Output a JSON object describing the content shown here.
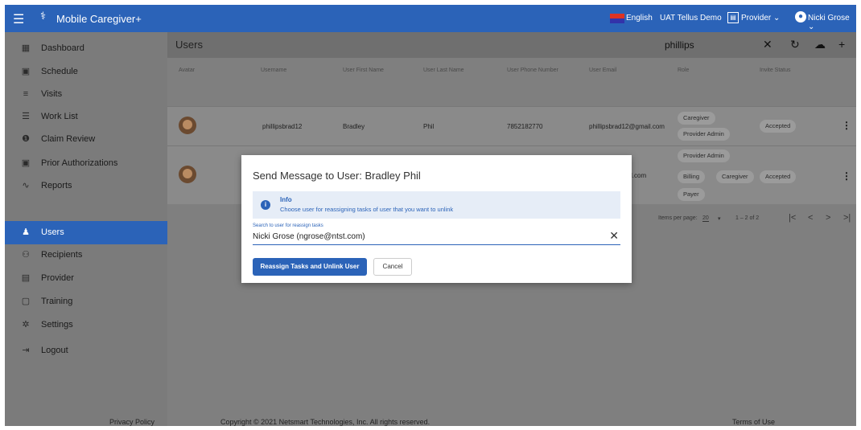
{
  "app": {
    "title": "Mobile Caregiver+"
  },
  "topbar": {
    "language": "English",
    "environment": "UAT Tellus Demo",
    "role_menu": "Provider",
    "user_menu": "Nicki Grose"
  },
  "sidebar": {
    "items": [
      {
        "label": "Dashboard",
        "icon": "dashboard-icon"
      },
      {
        "label": "Schedule",
        "icon": "calendar-icon"
      },
      {
        "label": "Visits",
        "icon": "filter-icon"
      },
      {
        "label": "Work List",
        "icon": "list-icon"
      },
      {
        "label": "Claim Review",
        "icon": "alert-icon"
      },
      {
        "label": "Prior Authorizations",
        "icon": "calendar-icon"
      },
      {
        "label": "Reports",
        "icon": "trend-icon"
      },
      {
        "label": "Users",
        "icon": "group-icon"
      },
      {
        "label": "Recipients",
        "icon": "people-icon"
      },
      {
        "label": "Provider",
        "icon": "clipboard-icon"
      },
      {
        "label": "Training",
        "icon": "video-icon"
      },
      {
        "label": "Settings",
        "icon": "gear-icon"
      },
      {
        "label": "Logout",
        "icon": "logout-icon"
      }
    ],
    "active": "Users"
  },
  "main": {
    "title": "Users",
    "search_value": "phillips",
    "columns": [
      "Avatar",
      "Username",
      "User First Name",
      "User Last Name",
      "User Phone Number",
      "User Email",
      "Role",
      "Invite Status"
    ],
    "rows": [
      {
        "username": "phillipsbrad12",
        "first_name": "Bradley",
        "last_name": "Phil",
        "phone": "7852182770",
        "email": "phillipsbrad12@gmail.com",
        "roles": [
          "Caregiver",
          "Provider Admin"
        ],
        "status": "Accepted"
      },
      {
        "email_partial": "l.com",
        "roles": [
          "Provider Admin",
          "Billing",
          "Caregiver",
          "Payer"
        ],
        "status": "Accepted"
      }
    ],
    "pagination": {
      "items_per_page_label": "Items per page:",
      "items_per_page": "20",
      "range": "1 – 2 of 2"
    }
  },
  "dialog": {
    "title": "Send Message to User: Bradley Phil",
    "info_title": "Info",
    "info_text": "Choose user for reassigning tasks of user that you want to unlink",
    "field_label": "Search to user for reassign tasks",
    "field_value": "Nicki Grose (ngrose@ntst.com)",
    "primary_button": "Reassign Tasks and Unlink User",
    "cancel_button": "Cancel"
  },
  "footer": {
    "privacy": "Privacy Policy",
    "copyright": "Copyright © 2021 Netsmart Technologies, Inc. All rights reserved.",
    "terms": "Terms of Use"
  }
}
